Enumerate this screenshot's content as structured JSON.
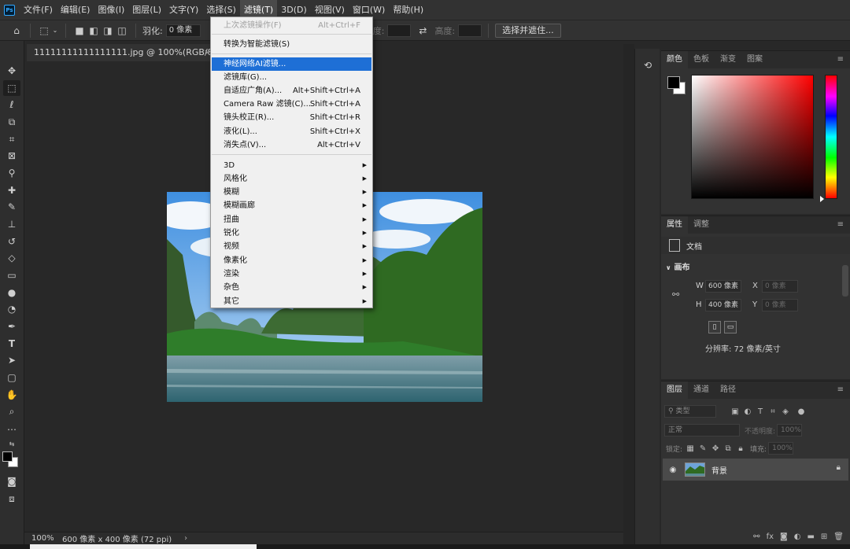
{
  "app": {
    "logo": "Ps"
  },
  "menubar": {
    "items": [
      "文件(F)",
      "编辑(E)",
      "图像(I)",
      "图层(L)",
      "文字(Y)",
      "选择(S)",
      "滤镜(T)",
      "3D(D)",
      "视图(V)",
      "窗口(W)",
      "帮助(H)"
    ],
    "active_index": 6
  },
  "options": {
    "feather_label": "羽化:",
    "feather_value": "0 像素",
    "width_label": "宽度:",
    "height_label": "高度:",
    "select_mask_button": "选择并遮住..."
  },
  "document": {
    "tab_title": "11111111111111111.jpg @ 100%(RGB/8#)",
    "tab_close": "×",
    "zoom": "100%",
    "status_info": "600 像素 x 400 像素 (72 ppi)",
    "status_arrow": "›"
  },
  "filter_menu": {
    "items": [
      {
        "label": "上次滤镜操作(F)",
        "shortcut": "Alt+Ctrl+F",
        "disabled": true
      },
      {
        "separator": true
      },
      {
        "label": "转换为智能滤镜(S)",
        "shortcut": ""
      },
      {
        "separator": true
      },
      {
        "label": "神经网络AI滤镜...",
        "shortcut": "",
        "highlight": true
      },
      {
        "label": "滤镜库(G)...",
        "shortcut": ""
      },
      {
        "label": "自适应广角(A)...",
        "shortcut": "Alt+Shift+Ctrl+A"
      },
      {
        "label": "Camera Raw 滤镜(C)...",
        "shortcut": "Shift+Ctrl+A"
      },
      {
        "label": "镜头校正(R)...",
        "shortcut": "Shift+Ctrl+R"
      },
      {
        "label": "液化(L)...",
        "shortcut": "Shift+Ctrl+X"
      },
      {
        "label": "消失点(V)...",
        "shortcut": "Alt+Ctrl+V"
      },
      {
        "separator": true
      },
      {
        "label": "3D",
        "submenu": true
      },
      {
        "label": "风格化",
        "submenu": true
      },
      {
        "label": "模糊",
        "submenu": true
      },
      {
        "label": "模糊画廊",
        "submenu": true
      },
      {
        "label": "扭曲",
        "submenu": true
      },
      {
        "label": "锐化",
        "submenu": true
      },
      {
        "label": "视频",
        "submenu": true
      },
      {
        "label": "像素化",
        "submenu": true
      },
      {
        "label": "渲染",
        "submenu": true
      },
      {
        "label": "杂色",
        "submenu": true
      },
      {
        "label": "其它",
        "submenu": true
      }
    ]
  },
  "color_panel": {
    "tabs": [
      "颜色",
      "色板",
      "渐变",
      "图案"
    ],
    "active_index": 0
  },
  "properties_panel": {
    "tabs": [
      "属性",
      "调整"
    ],
    "active_index": 0,
    "doc_label": "文档",
    "section": "画布",
    "w_label": "W",
    "w_value": "600 像素",
    "h_label": "H",
    "h_value": "400 像素",
    "x_label": "X",
    "x_value": "0 像素",
    "y_label": "Y",
    "y_value": "0 像素",
    "resolution": "分辨率: 72 像素/英寸"
  },
  "layers_panel": {
    "tabs": [
      "图层",
      "通道",
      "路径"
    ],
    "active_index": 0,
    "filter_placeholder": "类型",
    "blend_mode": "正常",
    "opacity_label": "不透明度:",
    "opacity_value": "100%",
    "lock_label": "锁定:",
    "fill_label": "填充:",
    "fill_value": "100%",
    "layer_name": "背景"
  },
  "colors": {
    "menu_highlight": "#1e6fd6",
    "foreground": "#000000",
    "background": "#ffffff"
  }
}
